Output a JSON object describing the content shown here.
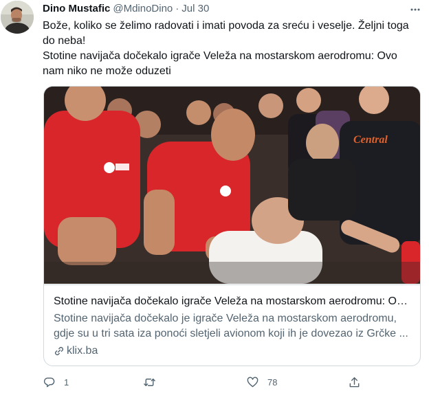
{
  "tweet": {
    "author": {
      "display_name": "Dino Mustafic",
      "handle": "@MdinoDino",
      "avatar_icon": "avatar"
    },
    "separator": "·",
    "date": "Jul 30",
    "more_icon": "more-icon",
    "text_lines": [
      "Bože, koliko se želimo radovati i imati povoda za sreću i veselje. Željni toga do neba!",
      "Stotine navijača dočekalo igrače Veleža na mostarskom aerodromu: Ovo nam niko ne može oduzeti"
    ],
    "card": {
      "title": "Stotine navijača dočekalo igrače Veleža na mostarskom aerodromu: Ov...",
      "description": "Stotine navijača dočekalo je igrače Veleža na mostarskom aerodromu, gdje su u tri sata iza ponoći sletjeli avionom koji ih je dovezao iz Grčke ...",
      "domain": "klix.ba",
      "shirt_text": "Central",
      "colors": {
        "shirt_red": "#d8262b",
        "background": "#3a2e2a"
      }
    },
    "actions": {
      "reply_count": "1",
      "retweet_count": "",
      "like_count": "78"
    },
    "colors": {
      "text": "#0f1419",
      "secondary": "#536471",
      "border": "#cfd9de"
    }
  }
}
